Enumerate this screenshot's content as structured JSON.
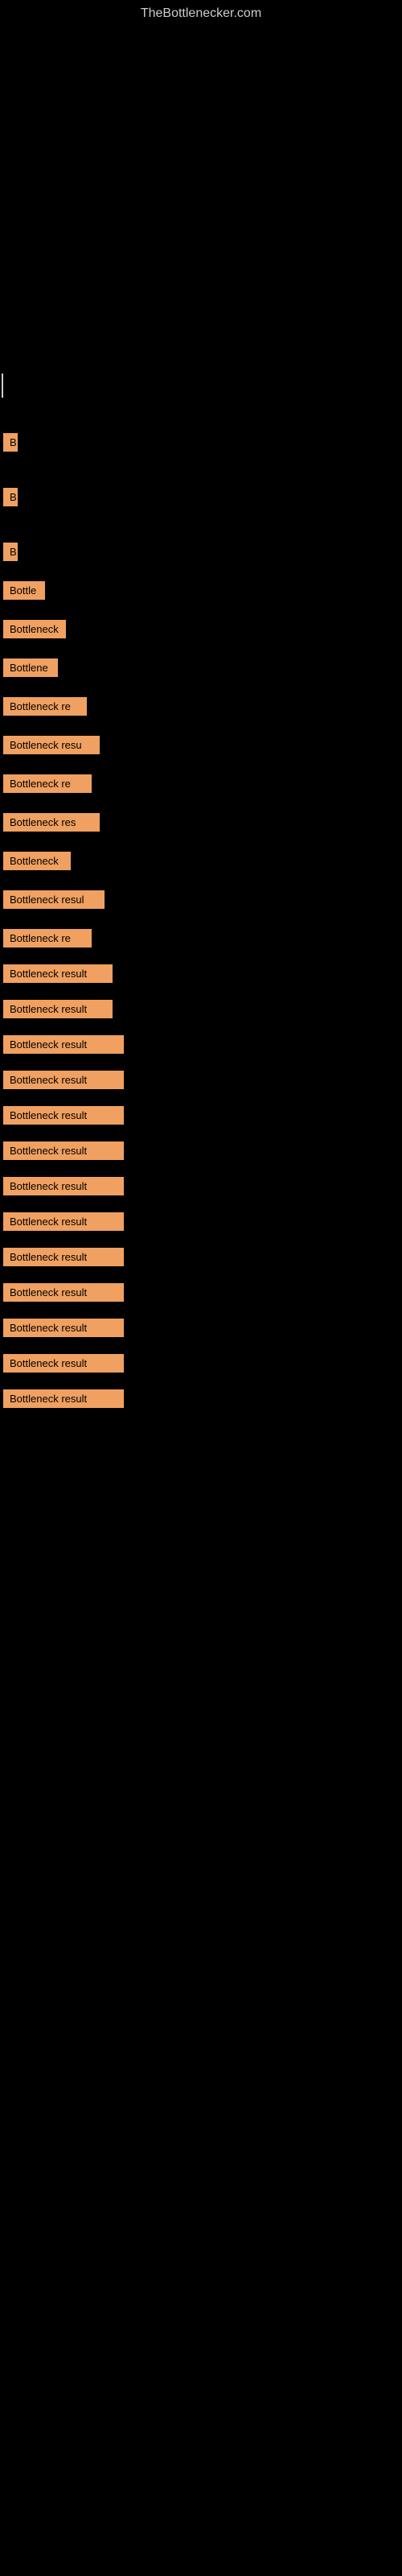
{
  "site": {
    "title": "TheBottlenecker.com"
  },
  "items": [
    {
      "id": 1,
      "label": "B",
      "bar_class": "bar-1"
    },
    {
      "id": 2,
      "label": "B",
      "bar_class": "bar-2"
    },
    {
      "id": 3,
      "label": "B",
      "bar_class": "bar-3"
    },
    {
      "id": 4,
      "label": "Bottle",
      "bar_class": "bar-4"
    },
    {
      "id": 5,
      "label": "Bottleneck",
      "bar_class": "bar-5"
    },
    {
      "id": 6,
      "label": "Bottlene",
      "bar_class": "bar-6"
    },
    {
      "id": 7,
      "label": "Bottleneck re",
      "bar_class": "bar-7"
    },
    {
      "id": 8,
      "label": "Bottleneck resu",
      "bar_class": "bar-8"
    },
    {
      "id": 9,
      "label": "Bottleneck re",
      "bar_class": "bar-9"
    },
    {
      "id": 10,
      "label": "Bottleneck res",
      "bar_class": "bar-10"
    },
    {
      "id": 11,
      "label": "Bottleneck",
      "bar_class": "bar-11"
    },
    {
      "id": 12,
      "label": "Bottleneck resul",
      "bar_class": "bar-12"
    },
    {
      "id": 13,
      "label": "Bottleneck re",
      "bar_class": "bar-13"
    },
    {
      "id": 14,
      "label": "Bottleneck result",
      "bar_class": "bar-14"
    },
    {
      "id": 15,
      "label": "Bottleneck result",
      "bar_class": "bar-15"
    },
    {
      "id": 16,
      "label": "Bottleneck result",
      "bar_class": "bar-16"
    },
    {
      "id": 17,
      "label": "Bottleneck result",
      "bar_class": "bar-17"
    },
    {
      "id": 18,
      "label": "Bottleneck result",
      "bar_class": "bar-18"
    },
    {
      "id": 19,
      "label": "Bottleneck result",
      "bar_class": "bar-19"
    },
    {
      "id": 20,
      "label": "Bottleneck result",
      "bar_class": "bar-20"
    },
    {
      "id": 21,
      "label": "Bottleneck result",
      "bar_class": "bar-21"
    },
    {
      "id": 22,
      "label": "Bottleneck result",
      "bar_class": "bar-22"
    },
    {
      "id": 23,
      "label": "Bottleneck result",
      "bar_class": "bar-23"
    },
    {
      "id": 24,
      "label": "Bottleneck result",
      "bar_class": "bar-24"
    },
    {
      "id": 25,
      "label": "Bottleneck result",
      "bar_class": "bar-25"
    },
    {
      "id": 26,
      "label": "Bottleneck result",
      "bar_class": "bar-26"
    }
  ]
}
